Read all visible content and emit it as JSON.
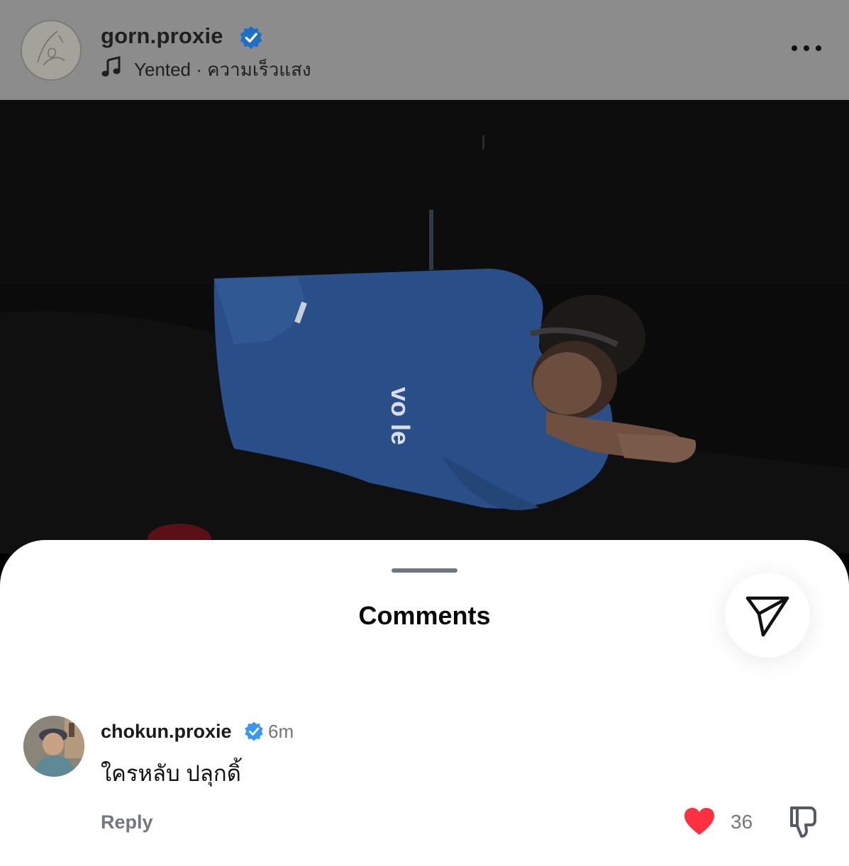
{
  "post": {
    "username": "gorn.proxie",
    "song": "Yented · ความเร็วแสง",
    "icons": {
      "verified": "verified-badge-icon",
      "music": "music-note-icon",
      "more": "more-horizontal-icon"
    },
    "photo_print": "vo le"
  },
  "comments_sheet": {
    "title": "Comments",
    "share_icon": "send-icon",
    "comments": [
      {
        "username": "chokun.proxie",
        "time": "6m",
        "text": "ใครหลับ ปลุกดิ้",
        "reply_label": "Reply",
        "like_count": "36",
        "liked": true
      }
    ]
  },
  "colors": {
    "verified": "#3897f0",
    "heart": "#ff3040",
    "shirt": "#2a5089",
    "muted_text": "#737780"
  }
}
